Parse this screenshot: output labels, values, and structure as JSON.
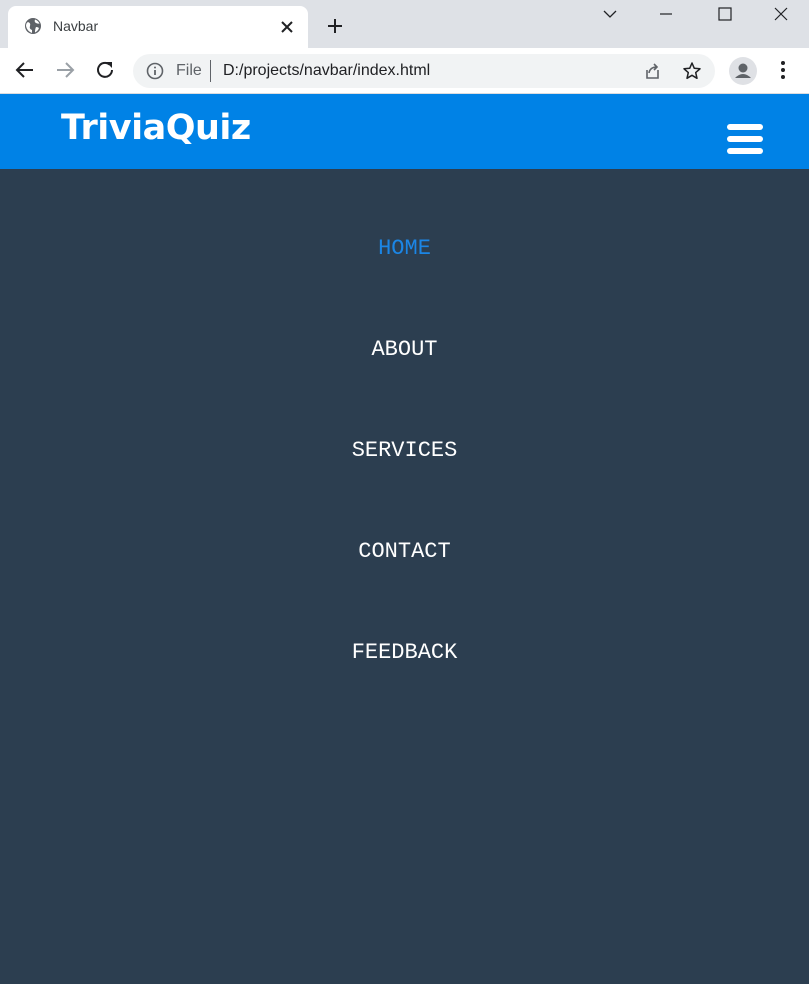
{
  "browser": {
    "tab_title": "Navbar",
    "address": {
      "scheme_label": "File",
      "url": "D:/projects/navbar/index.html"
    }
  },
  "site": {
    "logo": "TriviaQuiz",
    "menu": [
      {
        "label": "HOME",
        "active": true
      },
      {
        "label": "ABOUT",
        "active": false
      },
      {
        "label": "SERVICES",
        "active": false
      },
      {
        "label": "CONTACT",
        "active": false
      },
      {
        "label": "FEEDBACK",
        "active": false
      }
    ]
  },
  "colors": {
    "header": "#0082e6",
    "menu_bg": "#2c3e50",
    "active_link": "#1b86e6",
    "link": "#ffffff"
  },
  "icons": [
    "globe-icon",
    "close-icon",
    "plus-icon",
    "chevron-down-icon",
    "minimize-icon",
    "maximize-icon",
    "back-icon",
    "forward-icon",
    "reload-icon",
    "info-icon",
    "share-icon",
    "star-icon",
    "profile-icon",
    "kebab-menu-icon",
    "hamburger-icon"
  ]
}
